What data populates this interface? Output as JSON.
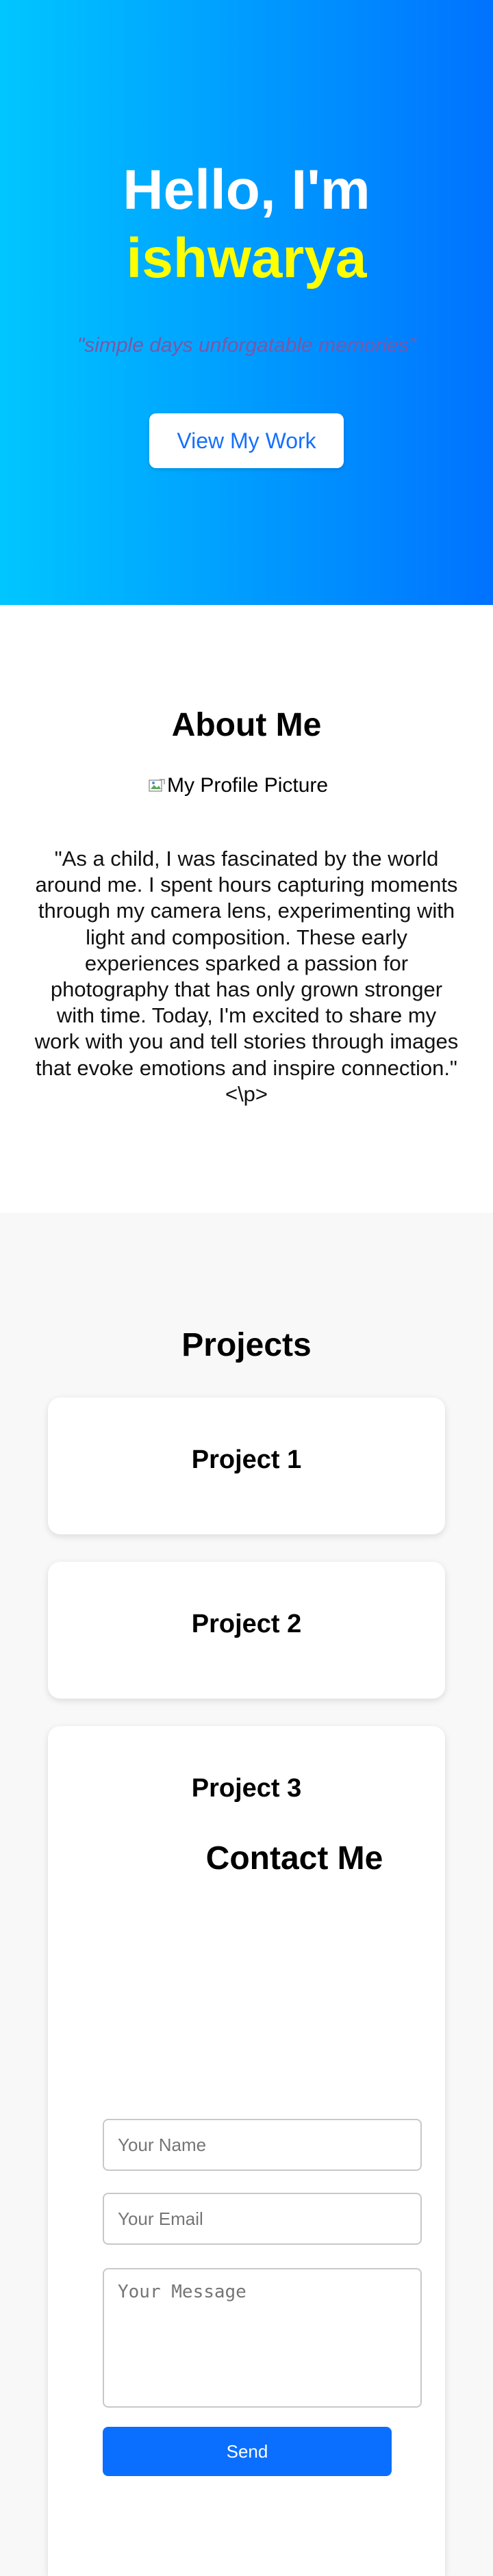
{
  "hero": {
    "greeting": "Hello, I'm",
    "name": "ishwarya",
    "tagline": "\"simple days unforgatable memories\"",
    "cta_label": "View My Work"
  },
  "about": {
    "title": "About Me",
    "profile_alt": "My Profile Picture",
    "text": "\"As a child, I was fascinated by the world around me. I spent hours capturing moments through my camera lens, experimenting with light and composition. These early experiences sparked a passion for photography that has only grown stronger with time. Today, I'm excited to share my work with you and tell stories through images that evoke emotions and inspire connection.\"<\\p>"
  },
  "projects": {
    "title": "Projects",
    "items": [
      {
        "title": "Project 1"
      },
      {
        "title": "Project 2"
      },
      {
        "title": "Project 3"
      }
    ]
  },
  "contact": {
    "title": "Contact Me",
    "name_placeholder": "Your Name",
    "email_placeholder": "Your Email",
    "message_placeholder": "Your Message",
    "send_label": "Send"
  },
  "colors": {
    "hero_gradient_start": "#00c6ff",
    "hero_gradient_end": "#0072ff",
    "name_highlight": "#ffff00",
    "tagline": "#7d56a6",
    "button_text": "#1470ff",
    "send_button": "#0a6eff"
  }
}
